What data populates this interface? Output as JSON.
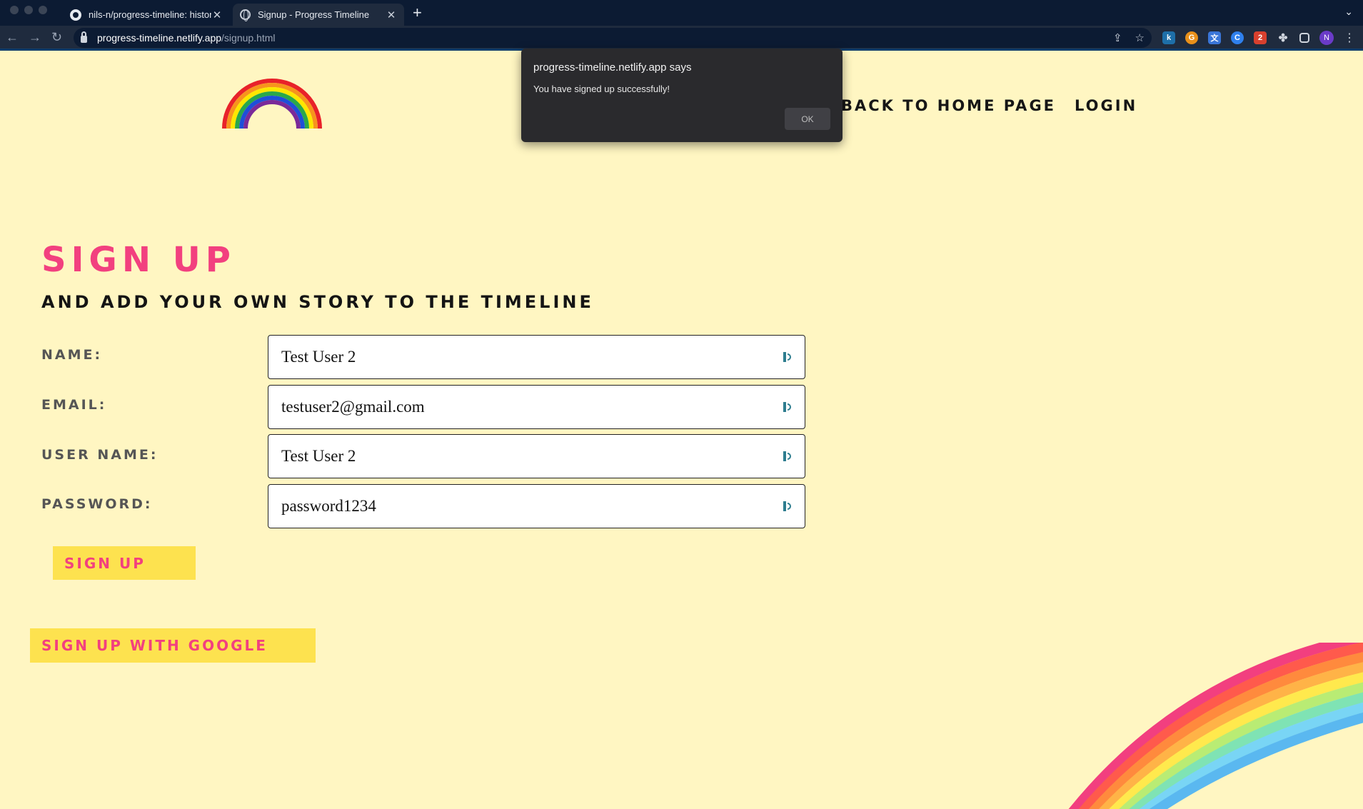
{
  "browser": {
    "tabs": [
      {
        "label": "nils-n/progress-timeline: histor",
        "icon": "github-icon",
        "active": false
      },
      {
        "label": "Signup - Progress Timeline",
        "icon": "globe-icon",
        "active": true
      }
    ],
    "url_host": "progress-timeline.netlify.app",
    "url_path": "/signup.html",
    "profile_initial": "N"
  },
  "header": {
    "nav": [
      "BACK TO HOME PAGE",
      "LOGIN"
    ]
  },
  "main": {
    "title": "SIGN UP",
    "subtitle": "AND ADD YOUR OWN STORY TO THE TIMELINE",
    "fields": [
      {
        "label": "NAME:",
        "value": "Test User 2"
      },
      {
        "label": "EMAIL:",
        "value": "testuser2@gmail.com"
      },
      {
        "label": "USER NAME:",
        "value": "Test User 2"
      },
      {
        "label": "PASSWORD:",
        "value": "password1234"
      }
    ],
    "signup_button": "SIGN UP",
    "google_button": "SIGN UP WITH GOOGLE"
  },
  "alert": {
    "title": "progress-timeline.netlify.app says",
    "message": "You have signed up successfully!",
    "ok_label": "OK"
  },
  "colors": {
    "page_background": "#fff6c2",
    "accent_pink": "#f2407f",
    "button_yellow": "#fde24f"
  }
}
